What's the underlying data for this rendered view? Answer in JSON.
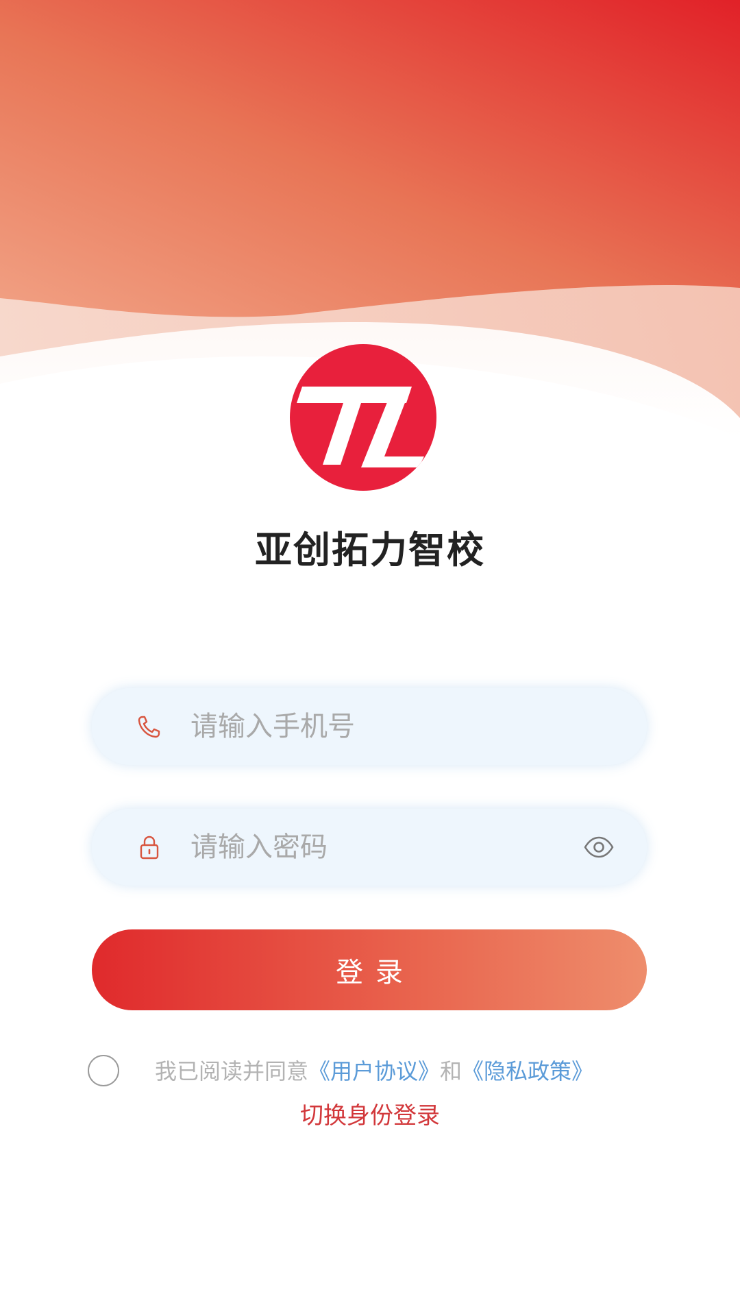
{
  "app": {
    "title": "亚创拓力智校",
    "logo_text": "TL"
  },
  "colors": {
    "brand_red": "#e8203c",
    "link_blue": "#5b9bd8",
    "switch_red": "#d2373a",
    "field_bg": "#eef6fd"
  },
  "form": {
    "phone": {
      "placeholder": "请输入手机号",
      "value": "",
      "icon": "phone-icon"
    },
    "password": {
      "placeholder": "请输入密码",
      "value": "",
      "icon": "lock-icon",
      "toggle_icon": "eye-icon"
    },
    "login_label": "登录"
  },
  "agreement": {
    "checked": false,
    "prefix": "我已阅读并同意",
    "user_agreement": "《用户协议》",
    "connector": "和",
    "privacy_policy": "《隐私政策》"
  },
  "switch_role_label": "切换身份登录"
}
